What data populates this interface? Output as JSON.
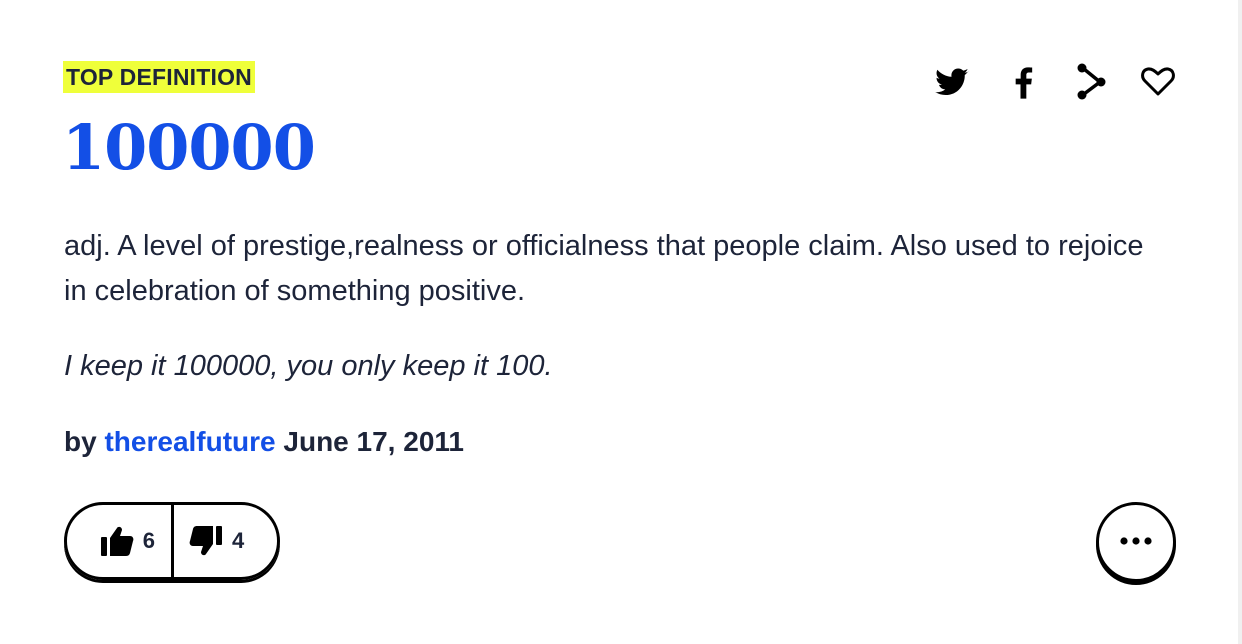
{
  "badge": "TOP DEFINITION",
  "word": "100000",
  "meaning": "adj. A level of prestige,realness or officialness that people claim. Also used to rejoice in celebration of something positive.",
  "example": "I keep it 100000, you only keep it 100.",
  "contributor": {
    "prefix": "by",
    "author": "therealfuture",
    "date": "June 17, 2011"
  },
  "votes": {
    "up": "6",
    "down": "4"
  },
  "share": [
    "twitter-icon",
    "facebook-icon",
    "share-icon",
    "heart-icon"
  ],
  "colors": {
    "accent": "#134fe6",
    "highlight": "#efff3a",
    "text": "#1d2439"
  }
}
